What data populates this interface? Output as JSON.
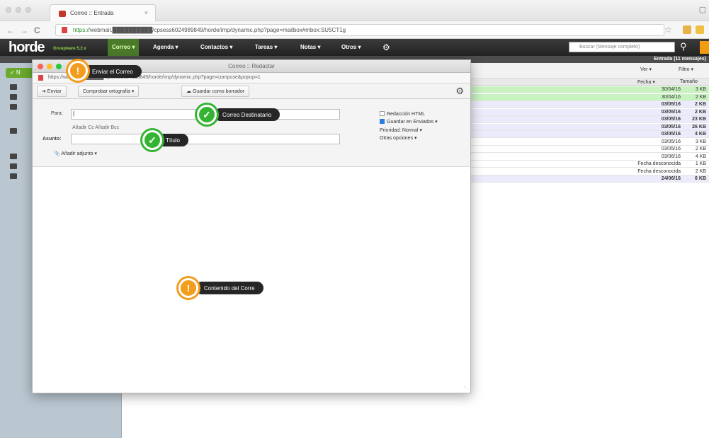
{
  "browser": {
    "tab_title": "Correo :: Entrada",
    "url_scheme": "https://",
    "url_rest": "webmail.██████████/cpsess6024989849/horde/imp/dynamic.php?page=mailbox#mbox:SU5CT1g",
    "close_glyph": "×",
    "back_glyph": "←",
    "forward_glyph": "→",
    "reload_glyph": "C",
    "star_glyph": "☆"
  },
  "horde": {
    "logo": "horde",
    "logo_sub": "Groupware 5.2.x",
    "menu": [
      "Correo ▾",
      "Agenda ▾",
      "Contactos ▾",
      "Tareas ▾",
      "Notas ▾",
      "Otros ▾"
    ],
    "search_placeholder": "Buscar (Mensaje completo)",
    "inbox_label": "Entrada (11 mensajes)"
  },
  "sidebar": {
    "new_button": "✓ N"
  },
  "mail_list": {
    "tools": [
      "Ver ▾",
      "Filtro ▾"
    ],
    "header": {
      "date": "Fecha ▾",
      "size": "Tamaño"
    },
    "rows": [
      {
        "date": "30/04/16",
        "size": "3 KB",
        "style": "green",
        "bold": false
      },
      {
        "date": "30/04/16",
        "size": "2 KB",
        "style": "green",
        "bold": false
      },
      {
        "date": "03/05/16",
        "size": "2 KB",
        "style": "lav",
        "bold": true
      },
      {
        "date": "03/05/16",
        "size": "2 KB",
        "style": "lav",
        "bold": true
      },
      {
        "date": "03/05/16",
        "size": "23 KB",
        "style": "lav",
        "bold": true
      },
      {
        "date": "03/05/16",
        "size": "26 KB",
        "style": "lav",
        "bold": true
      },
      {
        "date": "03/05/16",
        "size": "4 KB",
        "style": "lav",
        "bold": true
      },
      {
        "date": "03/05/16",
        "size": "3 KB",
        "style": "white",
        "bold": false
      },
      {
        "date": "03/05/16",
        "size": "2 KB",
        "style": "white",
        "bold": false
      },
      {
        "date": "03/06/16",
        "size": "4 KB",
        "style": "white",
        "bold": false
      },
      {
        "date": "Fecha desconocida",
        "size": "1 KB",
        "style": "white",
        "bold": false
      },
      {
        "date": "Fecha desconocida",
        "size": "2 KB",
        "style": "white",
        "bold": false
      },
      {
        "date": "24/06/16",
        "size": "6 KB",
        "style": "lav",
        "bold": true
      }
    ]
  },
  "compose": {
    "window_title": "Correo :: Redactar",
    "url": "https://webmail.██████/cpsess6024989849/horde/imp/dynamic.php?page=compose&popup=1",
    "send": "➔ Enviar",
    "spellcheck": "Comprobar ortografía ▾",
    "save_draft": "Guardar como borrador",
    "to_label": "Para:",
    "to_value": "|",
    "cc_bcc": "Añadir Cc  Añadir Bcc",
    "subject_label": "Asunto:",
    "attach": "Añadir adjunto ▾",
    "options": {
      "html": "Redacción HTML",
      "save_sent": "Guardar en Enviados ▾",
      "priority": "Prioridad: Normal ▾",
      "other": "Otras opciones ▾"
    }
  },
  "annotations": {
    "send": "Enviar el Correo",
    "recipient": "Correo Destinatario",
    "title": "Título",
    "content": "Contenido del Corre",
    "warn_glyph": "!",
    "check_glyph": "✓"
  },
  "colors": {
    "orange": "#f39c1e",
    "green": "#35b433",
    "horde_green": "#6aab2d"
  }
}
